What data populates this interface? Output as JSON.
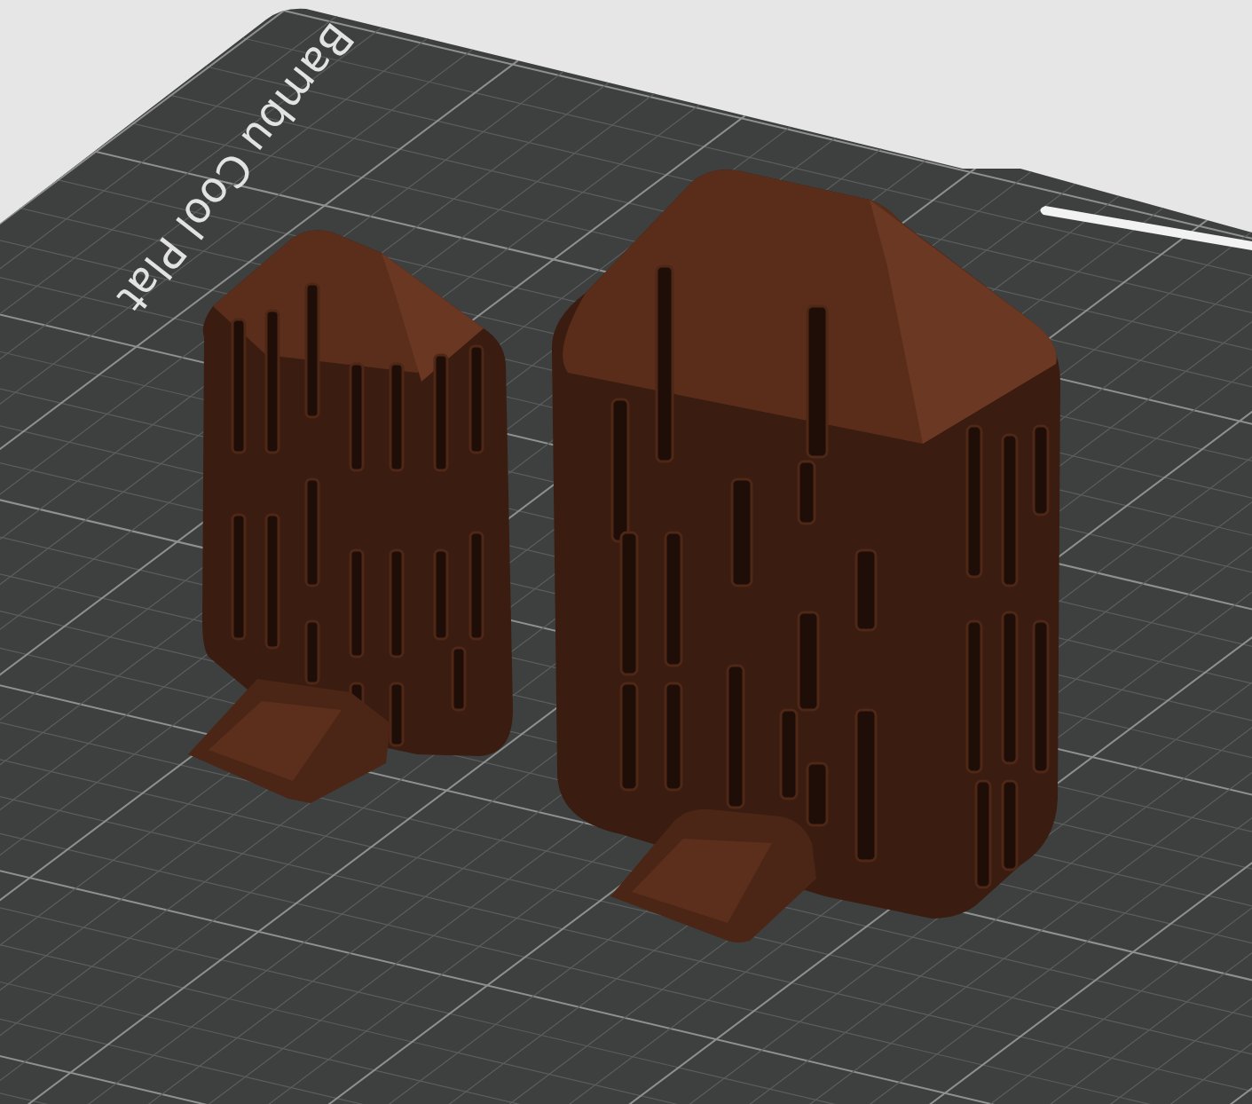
{
  "viewport": {
    "plate": {
      "label": "Bambu Cool Plat"
    }
  }
}
